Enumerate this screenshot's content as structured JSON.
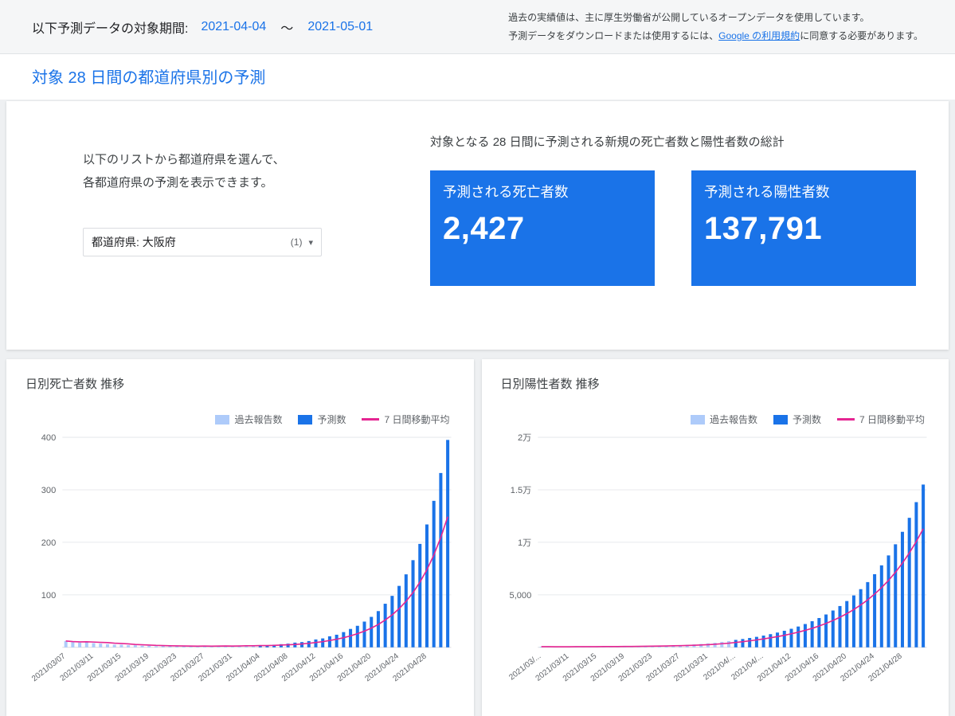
{
  "colors": {
    "accent_blue": "#1a73e8",
    "historical_bar": "#aecbfa",
    "forecast_bar": "#1a73e8",
    "moving_average": "#e52592"
  },
  "topbar": {
    "period_label": "以下予測データの対象期間:",
    "start_date": "2021-04-04",
    "tilde": "～",
    "end_date": "2021-05-01",
    "note_line1": "過去の実績値は、主に厚生労働省が公開しているオープンデータを使用しています。",
    "note_line2_prefix": "予測データをダウンロードまたは使用するには、",
    "note_line2_link": "Google の利用規約",
    "note_line2_suffix": "に同意する必要があります。"
  },
  "section": {
    "title": "対象 28 日間の都道府県別の予測"
  },
  "selector": {
    "instruction_line1": "以下のリストから都道府県を選んで、",
    "instruction_line2": "各都道府県の予測を表示できます。",
    "dropdown_value": "都道府県: 大阪府",
    "dropdown_count": "(1)",
    "dropdown_caret": "▾"
  },
  "summary": {
    "heading": "対象となる 28 日間に予測される新規の死亡者数と陽性者数の総計",
    "deaths": {
      "title": "予測される死亡者数",
      "value": "2,427"
    },
    "positives": {
      "title": "予測される陽性者数",
      "value": "137,791"
    }
  },
  "chart_data": [
    {
      "type": "bar",
      "title": "日別死亡者数 推移",
      "legend": [
        "過去報告数",
        "予測数",
        "7 日間移動平均"
      ],
      "ylim": [
        0,
        400
      ],
      "yticks": [
        100,
        200,
        300,
        400
      ],
      "ytick_labels": [
        "100",
        "200",
        "300",
        "400"
      ],
      "tick_every": 4,
      "x_tick_labels": [
        "2021/03/07",
        "2021/03/11",
        "2021/03/15",
        "2021/03/19",
        "2021/03/23",
        "2021/03/27",
        "2021/03/31",
        "2021/04/04",
        "2021/04/08",
        "2021/04/12",
        "2021/04/16",
        "2021/04/20",
        "2021/04/24",
        "2021/04/28"
      ],
      "historical_values": [
        12,
        10,
        9,
        11,
        8,
        7,
        6,
        5,
        5,
        4,
        4,
        3,
        3,
        2,
        3,
        2,
        2,
        3,
        2,
        2,
        3,
        2,
        3,
        3,
        2,
        3,
        4,
        4
      ],
      "forecast_values": [
        4,
        4,
        5,
        6,
        7,
        9,
        10,
        12,
        15,
        17,
        21,
        24,
        29,
        35,
        41,
        49,
        58,
        69,
        83,
        98,
        117,
        139,
        166,
        197,
        234,
        279,
        332,
        395
      ]
    },
    {
      "type": "bar",
      "title": "日別陽性者数 推移",
      "legend": [
        "過去報告数",
        "予測数",
        "7 日間移動平均"
      ],
      "ylim": [
        0,
        20000
      ],
      "yticks": [
        5000,
        10000,
        15000,
        20000
      ],
      "ytick_labels": [
        "5,000",
        "1万",
        "1.5万",
        "2万"
      ],
      "tick_every": 4,
      "x_tick_labels": [
        "2021/03/...",
        "2021/03/11",
        "2021/03/15",
        "2021/03/19",
        "2021/03/23",
        "2021/03/27",
        "2021/03/31",
        "2021/04/...",
        "2021/04/...",
        "2021/04/12",
        "2021/04/16",
        "2021/04/20",
        "2021/04/24",
        "2021/04/28"
      ],
      "historical_values": [
        62,
        54,
        51,
        58,
        60,
        63,
        68,
        66,
        72,
        78,
        88,
        95,
        100,
        108,
        118,
        128,
        140,
        153,
        168,
        188,
        208,
        238,
        278,
        320,
        378,
        438,
        518,
        598
      ],
      "forecast_values": [
        708,
        793,
        890,
        997,
        1118,
        1254,
        1405,
        1576,
        1766,
        1980,
        2220,
        2489,
        2790,
        3128,
        3507,
        3932,
        4408,
        4942,
        5540,
        6211,
        6964,
        7807,
        8752,
        9812,
        11000,
        12332,
        13826,
        15500
      ]
    }
  ]
}
